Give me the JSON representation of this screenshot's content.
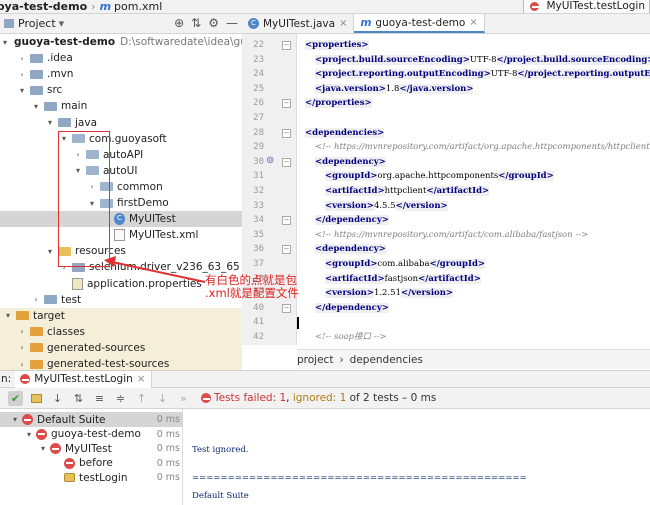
{
  "topbar": {
    "project": "oya-test-demo",
    "separator": "›",
    "file": "pom.xml",
    "file_icon": "m",
    "run_config": "MyUITest.testLogin",
    "hammer_icon": "hammer-icon"
  },
  "project_panel": {
    "title": "Project",
    "dropdown": "▾",
    "tools": [
      "⚙",
      "⇅",
      "⚙",
      "—"
    ]
  },
  "tree": [
    {
      "label": "guoya-test-demo",
      "path": "D:\\softwaredate\\idea\\guoya-te",
      "arrow": "▾",
      "icon": "folder",
      "indent": 0,
      "bold": true
    },
    {
      "label": ".idea",
      "arrow": "›",
      "icon": "folder",
      "indent": 1
    },
    {
      "label": ".mvn",
      "arrow": "›",
      "icon": "folder",
      "indent": 1
    },
    {
      "label": "src",
      "arrow": "▾",
      "icon": "folder",
      "indent": 1
    },
    {
      "label": "main",
      "arrow": "▾",
      "icon": "folder",
      "indent": 2
    },
    {
      "label": "java",
      "arrow": "▾",
      "icon": "folder",
      "indent": 3
    },
    {
      "label": "com.guoyasoft",
      "arrow": "▾",
      "icon": "package",
      "indent": 4
    },
    {
      "label": "autoAPI",
      "arrow": "›",
      "icon": "package",
      "indent": 5
    },
    {
      "label": "autoUI",
      "arrow": "▾",
      "icon": "package",
      "indent": 5
    },
    {
      "label": "common",
      "arrow": "›",
      "icon": "package",
      "indent": 6
    },
    {
      "label": "firstDemo",
      "arrow": "▾",
      "icon": "package",
      "indent": 6
    },
    {
      "label": "MyUITest",
      "arrow": "",
      "icon": "class",
      "indent": 7,
      "selected": true
    },
    {
      "label": "MyUITest.xml",
      "arrow": "",
      "icon": "file",
      "indent": 7
    },
    {
      "label": "resources",
      "arrow": "▾",
      "icon": "folder-res",
      "indent": 3
    },
    {
      "label": "selenium.driver_v236_63_65",
      "arrow": "›",
      "icon": "folder",
      "indent": 4
    },
    {
      "label": "application.properties",
      "arrow": "",
      "icon": "props",
      "indent": 4
    },
    {
      "label": "test",
      "arrow": "›",
      "icon": "folder",
      "indent": 2
    },
    {
      "label": "target",
      "arrow": "▾",
      "icon": "folder-orange",
      "indent": 0,
      "target": true
    },
    {
      "label": "classes",
      "arrow": "›",
      "icon": "folder-orange",
      "indent": 1,
      "target": true
    },
    {
      "label": "generated-sources",
      "arrow": "›",
      "icon": "folder-orange",
      "indent": 1,
      "target": true
    },
    {
      "label": "generated-test-sources",
      "arrow": "›",
      "icon": "folder-orange",
      "indent": 1,
      "target": true
    }
  ],
  "tabs": [
    {
      "label": "MyUITest.java",
      "icon": "C",
      "active": false,
      "close": "×"
    },
    {
      "label": "guoya-test-demo",
      "icon": "m",
      "active": true,
      "close": "×"
    }
  ],
  "editor": {
    "lines": [
      {
        "n": "22",
        "text": [
          [
            "tg",
            "<properties>"
          ]
        ],
        "indent": 0
      },
      {
        "n": "23",
        "text": [
          [
            "tg",
            "<project.build.sourceEncoding>"
          ],
          [
            "t",
            "UTF-8"
          ],
          [
            "tg",
            "</project.build.sourceEncoding>"
          ]
        ],
        "indent": 1
      },
      {
        "n": "24",
        "text": [
          [
            "tg",
            "<project.reporting.outputEncoding>"
          ],
          [
            "t",
            "UTF-8"
          ],
          [
            "tg",
            "</project.reporting.outputEncoding>"
          ]
        ],
        "indent": 1
      },
      {
        "n": "25",
        "text": [
          [
            "tg",
            "<java.version>"
          ],
          [
            "t",
            "1.8"
          ],
          [
            "tg",
            "</java.version>"
          ]
        ],
        "indent": 1
      },
      {
        "n": "26",
        "text": [
          [
            "tg",
            "</properties>"
          ]
        ],
        "indent": 0
      },
      {
        "n": "27",
        "text": [],
        "indent": 0
      },
      {
        "n": "28",
        "text": [
          [
            "tg",
            "<dependencies>"
          ]
        ],
        "indent": 0
      },
      {
        "n": "29",
        "text": [
          [
            "cm",
            "<!-- https://mvnrepository.com/artifact/org.apache.httpcomponents/httpclient -->"
          ]
        ],
        "indent": 1
      },
      {
        "n": "30",
        "text": [
          [
            "tg",
            "<dependency>"
          ]
        ],
        "indent": 1
      },
      {
        "n": "31",
        "text": [
          [
            "tg",
            "<groupId>"
          ],
          [
            "t",
            "org.apache.httpcomponents"
          ],
          [
            "tg",
            "</groupId>"
          ]
        ],
        "indent": 2
      },
      {
        "n": "32",
        "text": [
          [
            "tg",
            "<artifactId>"
          ],
          [
            "t",
            "httpclient"
          ],
          [
            "tg",
            "</artifactId>"
          ]
        ],
        "indent": 2
      },
      {
        "n": "33",
        "text": [
          [
            "tg",
            "<version>"
          ],
          [
            "t",
            "4.5.5"
          ],
          [
            "tg",
            "</version>"
          ]
        ],
        "indent": 2
      },
      {
        "n": "34",
        "text": [
          [
            "tg",
            "</dependency>"
          ]
        ],
        "indent": 1
      },
      {
        "n": "35",
        "text": [
          [
            "cm",
            "<!-- https://mvnrepository.com/artifact/com.alibaba/fastjson -->"
          ]
        ],
        "indent": 1
      },
      {
        "n": "36",
        "text": [
          [
            "tg",
            "<dependency>"
          ]
        ],
        "indent": 1
      },
      {
        "n": "37",
        "text": [
          [
            "tg",
            "<groupId>"
          ],
          [
            "t",
            "com.alibaba"
          ],
          [
            "tg",
            "</groupId>"
          ]
        ],
        "indent": 2
      },
      {
        "n": "38",
        "text": [
          [
            "tg",
            "<artifactId>"
          ],
          [
            "t",
            "fastjson"
          ],
          [
            "tg",
            "</artifactId>"
          ]
        ],
        "indent": 2
      },
      {
        "n": "39",
        "text": [
          [
            "tg",
            "<version>"
          ],
          [
            "t",
            "1.2.51"
          ],
          [
            "tg",
            "</version>"
          ]
        ],
        "indent": 2
      },
      {
        "n": "40",
        "text": [
          [
            "tg",
            "</dependency>"
          ]
        ],
        "indent": 1
      },
      {
        "n": "41",
        "text": [],
        "indent": 0
      },
      {
        "n": "42",
        "text": [
          [
            "cm",
            "<!-- soap接口 -->"
          ]
        ],
        "indent": 1
      }
    ],
    "breadcrumbs": [
      "project",
      "›",
      "dependencies"
    ]
  },
  "annotation": {
    "line1": "有白色的点就是包",
    "line2": ".xml就是配置文件",
    "color": "#e02020"
  },
  "run": {
    "label": "n:",
    "config": "MyUITest.testLogin",
    "close": "×",
    "status_prefix": "Tests failed: ",
    "failed": "1",
    "sep1": ", ",
    "ignored_label": "ignored: ",
    "ignored": "1",
    "rest": " of 2 tests – 0 ms",
    "tree": [
      {
        "label": "Default Suite",
        "ms": "0 ms",
        "indent": 0,
        "arrow": "▾",
        "icon": "fail",
        "selected": true
      },
      {
        "label": "guoya-test-demo",
        "ms": "0 ms",
        "indent": 1,
        "arrow": "▾",
        "icon": "fail"
      },
      {
        "label": "MyUITest",
        "ms": "0 ms",
        "indent": 2,
        "arrow": "▾",
        "icon": "fail"
      },
      {
        "label": "before",
        "ms": "0 ms",
        "indent": 3,
        "arrow": "",
        "icon": "fail"
      },
      {
        "label": "testLogin",
        "ms": "0 ms",
        "indent": 3,
        "arrow": "",
        "icon": "ignored"
      }
    ],
    "console": [
      "Test ignored.",
      "===============================================",
      "Default Suite"
    ]
  }
}
